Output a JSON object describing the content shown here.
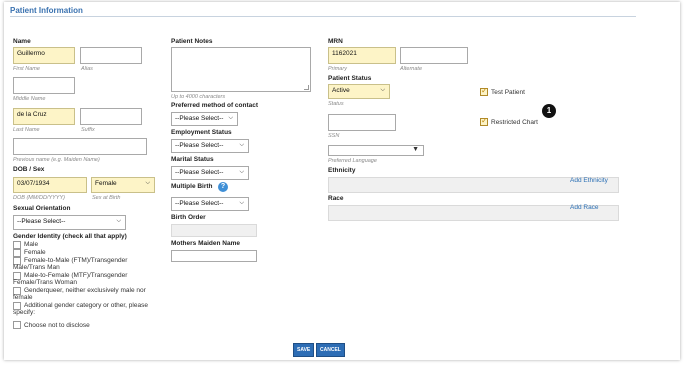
{
  "page": {
    "title": "Patient Information"
  },
  "name_section": {
    "label": "Name",
    "first_name_value": "Guillermo",
    "first_name_hint": "First Name",
    "alias_value": "",
    "alias_hint": "Alias",
    "middle_name_value": "",
    "middle_name_hint": "Middle Name",
    "last_name_value": "de la Cruz",
    "last_name_hint": "Last Name",
    "suffix_value": "",
    "suffix_hint": "Suffix",
    "previous_name_value": "",
    "previous_name_hint": "Previous name (e.g. Maiden Name)"
  },
  "dob_sex": {
    "label": "DOB / Sex",
    "dob_value": "03/07/1934",
    "dob_hint": "DOB (MM/DD/YYYY)",
    "sex_value": "Female",
    "sex_hint": "Sex at Birth"
  },
  "sexual_orientation": {
    "label": "Sexual Orientation",
    "value": "--Please Select--"
  },
  "gender_identity": {
    "label": "Gender Identity (check all that apply)",
    "options": [
      "Male",
      "Female",
      "Female-to-Male (FTM)/Transgender Male/Trans Man",
      "Male-to-Female (MTF)/Transgender Female/Trans Woman",
      "Genderqueer, neither exclusively male nor female",
      "Additional gender category or other, please specify:",
      "Choose not to disclose"
    ]
  },
  "patient_notes": {
    "label": "Patient Notes",
    "value": "",
    "hint": "Up to 4000 characters"
  },
  "contact_method": {
    "label": "Preferred method of contact",
    "value": "--Please Select--"
  },
  "employment_status": {
    "label": "Employment Status",
    "value": "--Please Select--"
  },
  "marital_status": {
    "label": "Marital Status",
    "value": "--Please Select--"
  },
  "multiple_birth": {
    "label": "Multiple Birth",
    "value": "--Please Select--",
    "help_icon": "question-icon"
  },
  "birth_order": {
    "label": "Birth Order",
    "value": ""
  },
  "mothers_maiden_name": {
    "label": "Mothers Maiden Name",
    "value": ""
  },
  "mrn": {
    "label": "MRN",
    "primary_value": "1162021",
    "primary_hint": "Primary",
    "alternate_value": "",
    "alternate_hint": "Alternate"
  },
  "patient_status": {
    "label": "Patient Status",
    "value": "Active",
    "hint": "Status"
  },
  "ssn": {
    "value": "",
    "hint": "SSN"
  },
  "preferred_language": {
    "value": "",
    "hint": "Preferred Language"
  },
  "ethnicity": {
    "label": "Ethnicity",
    "link": "Add Ethnicity"
  },
  "race": {
    "label": "Race",
    "link": "Add Race"
  },
  "flags": {
    "test_patient_label": "Test Patient",
    "test_patient_checked": true,
    "restricted_chart_label": "Restricted Chart",
    "restricted_chart_checked": true
  },
  "callout": {
    "number": "1"
  },
  "buttons": {
    "save": "SAVE",
    "cancel": "CANCEL"
  },
  "colors": {
    "accent": "#3a72b0",
    "required_bg": "#fdf4c7",
    "button": "#2d6db5"
  }
}
